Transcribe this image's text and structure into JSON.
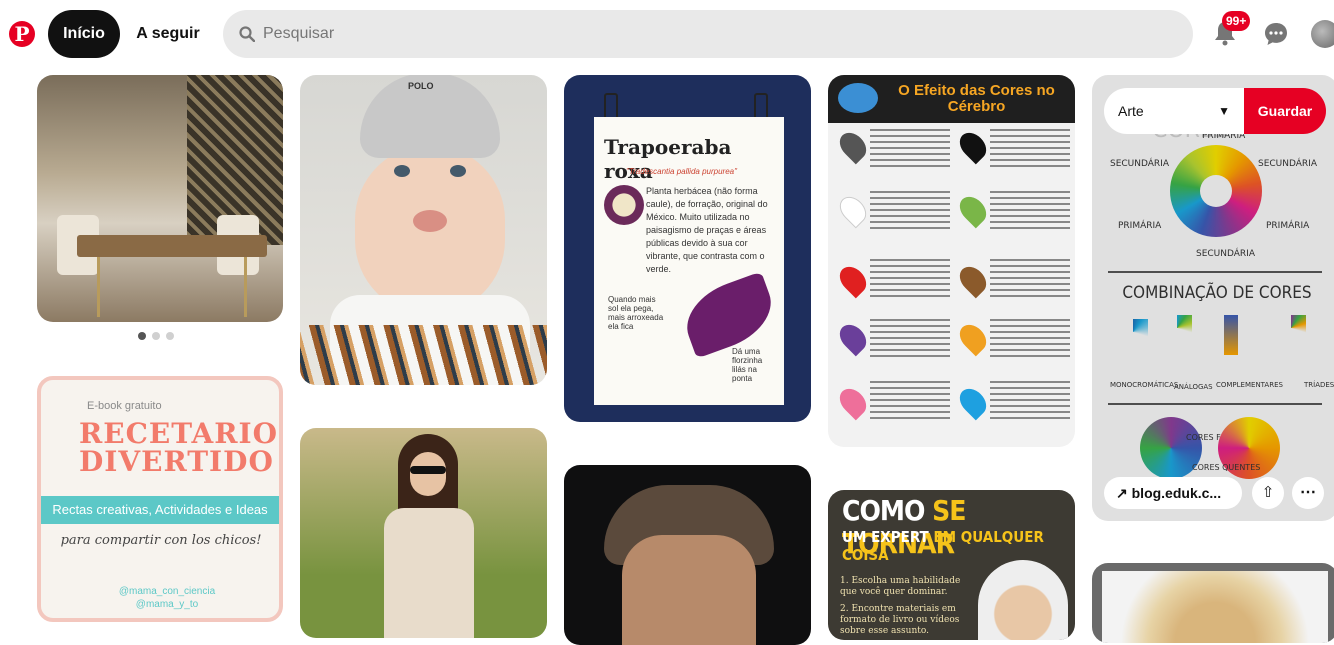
{
  "header": {
    "logo_letter": "P",
    "nav": {
      "home": "Início",
      "following": "A seguir"
    },
    "search_placeholder": "Pesquisar",
    "notifications_badge": "99+"
  },
  "pins": {
    "dining_room": {
      "carousel_dots": 3,
      "active_dot": 1
    },
    "baby": {
      "cap_text": "POLO"
    },
    "trapoeraba": {
      "title": "Trapoeraba roxa",
      "subtitle": "\"Tradescantia pallida purpurea\"",
      "body": "Planta herbácea (não forma caule), de forração, original do México. Muito utilizada no paisagismo de praças e áreas públicas devido à sua cor vibrante, que contrasta com o verde.",
      "note_left": "Quando mais sol ela pega, mais arroxeada ela fica",
      "note_right": "Dá uma florzinha lilás na ponta"
    },
    "efeito_cores": {
      "title": "O Efeito das Cores no Cérebro"
    },
    "teoria_cores": {
      "board_label": "Arte",
      "save_label": "Guardar",
      "title": "TEORIA DAS CORES",
      "labels": {
        "primaria": "PRIMÁRIA",
        "secundaria": "SECUNDÁRIA"
      },
      "combo_title": "COMBINAÇÃO DE CORES",
      "combo_types": [
        "MONOCROMÁTICAS",
        "ANÁLOGAS",
        "COMPLEMENTARES",
        "TRÍADES"
      ],
      "cores_frias": "CORES FRIAS",
      "cores_quentes": "CORES QUENTES",
      "link_label": "blog.eduk.c..."
    },
    "recetario": {
      "ebook": "E-book gratuito",
      "title": "RECETARIO DIVERTIDO",
      "band": "Rectas creativas, Actividades e Ideas",
      "tagline": "para compartir con los chicos!",
      "handle1": "@mama_con_ciencia",
      "handle2": "@mama_y_to"
    },
    "como_tornar": {
      "line1_a": "COMO",
      "line1_b": "SE TORNAR",
      "line2_a": "UM EXPERT",
      "line2_b": "EM QUALQUER COISA",
      "step1": "1. Escolha uma habilidade que você quer dominar.",
      "step2": "2. Encontre materiais em formato de livro ou vídeos sobre esse assunto."
    }
  },
  "colors": {
    "brand_red": "#e60023",
    "nav_active_bg": "#111111",
    "search_bg": "#e9e9e9"
  }
}
